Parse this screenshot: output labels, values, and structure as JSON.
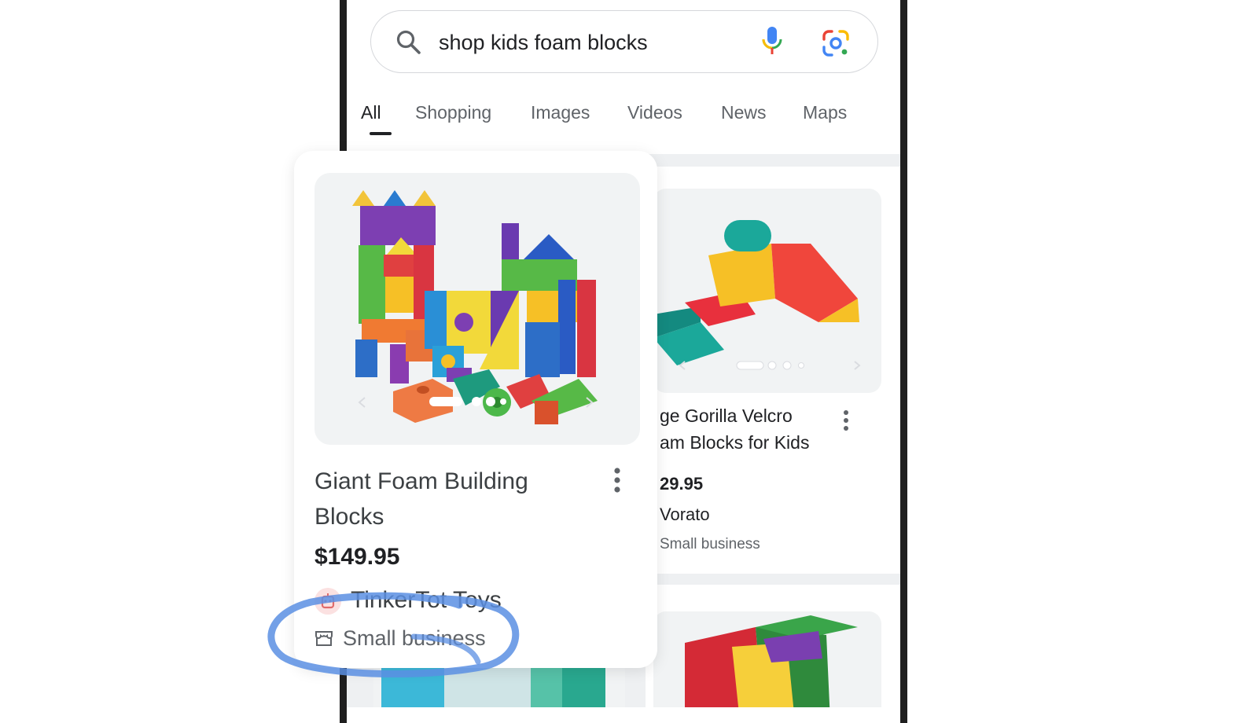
{
  "search": {
    "query": "shop kids foam blocks"
  },
  "tabs": [
    {
      "label": "All",
      "active": true
    },
    {
      "label": "Shopping"
    },
    {
      "label": "Images"
    },
    {
      "label": "Videos"
    },
    {
      "label": "News"
    },
    {
      "label": "Maps"
    }
  ],
  "featured_product": {
    "title": "Giant Foam Building Blocks",
    "price": "$149.95",
    "store": "TinkerTot Toys",
    "badge": "Small business",
    "image_icon": "toy-blocks-image"
  },
  "second_product": {
    "title_line1": "ge Gorilla Velcro",
    "title_line2": "am Blocks for Kids",
    "price": "29.95",
    "store": "Vorato",
    "badge": "Small business"
  },
  "colors": {
    "highlight": "#5b8fe3",
    "google_blue": "#4285f4",
    "google_red": "#ea4335",
    "google_yellow": "#fbbc05",
    "google_green": "#34a853"
  }
}
